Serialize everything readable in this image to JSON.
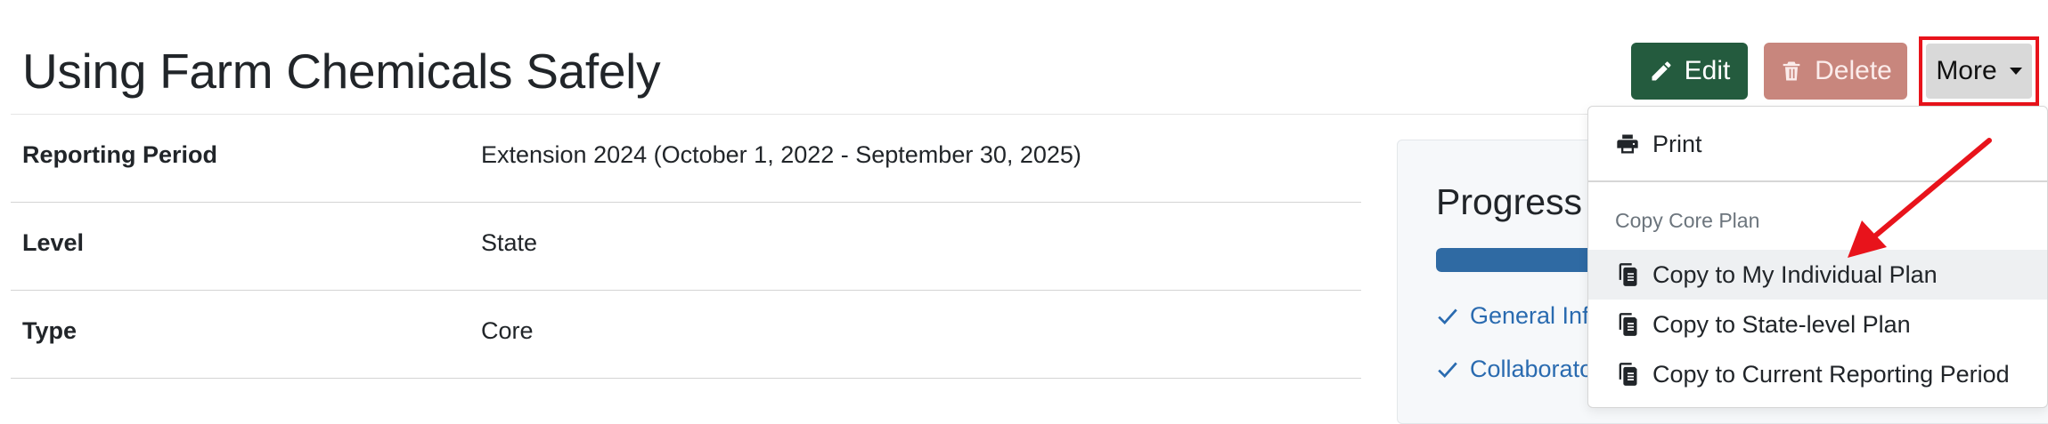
{
  "page": {
    "title": "Using Farm Chemicals Safely"
  },
  "actions": {
    "edit_label": "Edit",
    "delete_label": "Delete",
    "more_label": "More"
  },
  "details": {
    "rows": [
      {
        "label": "Reporting Period",
        "value": "Extension 2024 (October 1, 2022 - September 30, 2025)"
      },
      {
        "label": "Level",
        "value": "State"
      },
      {
        "label": "Type",
        "value": "Core"
      }
    ]
  },
  "progress": {
    "title": "Progress",
    "items": [
      "General Inf",
      "Collaborato"
    ]
  },
  "more_menu": {
    "print_label": "Print",
    "section_header": "Copy Core Plan",
    "items": [
      "Copy to My Individual Plan",
      "Copy to State-level Plan",
      "Copy to Current Reporting Period"
    ]
  },
  "colors": {
    "edit_button": "#245b3e",
    "delete_button": "#c8867d",
    "highlight_box": "#e8131b",
    "progress_fill": "#2f6aa3",
    "link": "#2a6bb0"
  },
  "icons": {
    "edit": "pencil-icon",
    "delete": "trash-icon",
    "print": "printer-icon",
    "copy": "copy-document-icon",
    "check": "checkmark-icon"
  }
}
